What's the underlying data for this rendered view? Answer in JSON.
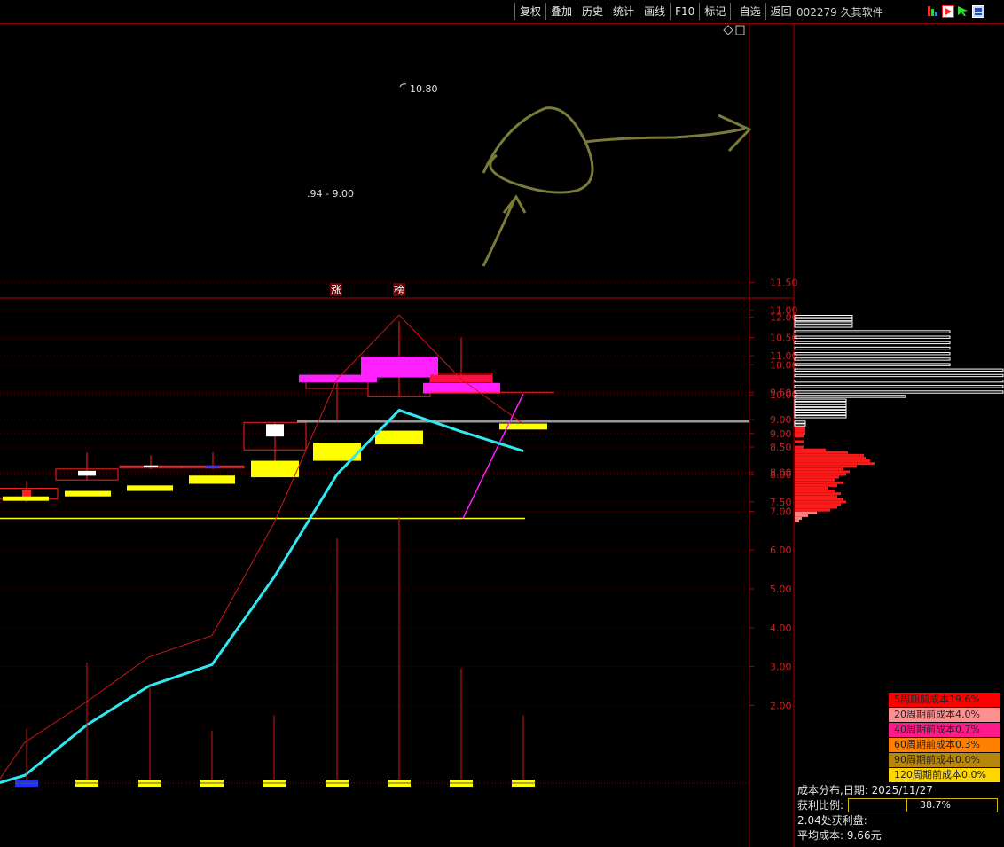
{
  "toolbar": {
    "buttons": [
      "复权",
      "叠加",
      "历史",
      "统计",
      "画线",
      "F10",
      "标记",
      "-自选",
      "返回"
    ],
    "stock_title": "002279 久其软件"
  },
  "colors": {
    "background": "#000000",
    "axis_red": "#b00000",
    "up_red": "#ff2020",
    "magenta": "#ff20ff",
    "yellow": "#ffff00",
    "cyan": "#30e8f0",
    "olive_annotation": "#7a7a3a"
  },
  "chart_data": [
    {
      "type": "candlestick",
      "panel": "price",
      "ylim": [
        7.1,
        11.85
      ],
      "yticks": [
        "11.50",
        "11.00",
        "10.50",
        "10.00",
        "9.50",
        "9.00",
        "8.50",
        "8.00",
        "7.50"
      ],
      "candles": [
        {
          "open": 7.55,
          "close": 7.75,
          "high": 7.88,
          "low": 7.5,
          "color": "red"
        },
        {
          "open": 8.1,
          "close": 7.9,
          "high": 8.4,
          "low": 7.9,
          "color": "white"
        },
        {
          "open": 8.15,
          "close": 8.15,
          "high": 8.35,
          "low": 8.1,
          "color": "doji"
        },
        {
          "open": 8.15,
          "close": 8.12,
          "high": 8.4,
          "low": 8.1,
          "color": "doji"
        },
        {
          "open": 8.95,
          "close": 8.45,
          "high": 8.95,
          "low": 7.95,
          "color": "white"
        },
        {
          "open": 9.57,
          "close": 9.8,
          "high": 9.8,
          "low": 9.0,
          "color": "red"
        },
        {
          "open": 9.42,
          "close": 9.88,
          "high": 10.8,
          "low": 9.4,
          "color": "red"
        },
        {
          "open": 9.85,
          "close": 9.55,
          "high": 10.5,
          "low": 9.5,
          "color": "red"
        }
      ],
      "yellow_boxes": [
        {
          "top": 7.6,
          "bottom": 7.52
        },
        {
          "top": 7.7,
          "bottom": 7.6
        },
        {
          "top": 7.8,
          "bottom": 7.7
        },
        {
          "top": 7.98,
          "bottom": 7.83
        },
        {
          "top": 8.25,
          "bottom": 7.95
        },
        {
          "top": 8.58,
          "bottom": 8.25
        },
        {
          "top": 8.8,
          "bottom": 8.55
        },
        {
          "top": 8.93,
          "bottom": 8.82
        }
      ],
      "magenta_boxes": [
        {
          "top": 9.82,
          "bottom": 9.68
        },
        {
          "top": 10.15,
          "bottom": 9.77
        },
        {
          "top": 9.67,
          "bottom": 9.48
        }
      ],
      "price_labels": {
        "high_label": "10.80",
        "range_label": ".94 - 9.00"
      },
      "markers": [
        "涨",
        "榜"
      ],
      "support_line": 7.2,
      "resistance_line": 8.97
    },
    {
      "type": "line",
      "panel": "indicator",
      "ylim": [
        0,
        12.3
      ],
      "yticks": [
        "12.00",
        "11.00",
        "10.00",
        "9.00",
        "8.00",
        "7.00",
        "6.00",
        "5.00",
        "4.00",
        "3.00",
        "2.00"
      ],
      "series": [
        {
          "color": "red",
          "values": [
            0.05,
            1.05,
            2.1,
            3.25,
            3.8,
            6.7,
            10.4,
            12.05,
            10.4,
            9.25
          ]
        },
        {
          "color": "cyan",
          "values": [
            0.0,
            0.2,
            1.5,
            2.5,
            3.05,
            5.3,
            7.95,
            9.6,
            9.05,
            8.55
          ]
        }
      ],
      "bars": [
        1.4,
        3.1,
        2.45,
        1.35,
        1.75,
        6.3,
        6.85,
        2.95,
        1.75
      ],
      "bar_markers": [
        "blue",
        "yellow",
        "yellow",
        "yellow",
        "yellow",
        "yellow",
        "yellow",
        "yellow",
        "yellow"
      ]
    },
    {
      "type": "bar",
      "panel": "cost_distribution",
      "ylim": [
        7.1,
        11.85
      ],
      "bins_price": [
        10.88,
        10.82,
        10.76,
        10.7,
        10.6,
        10.5,
        10.4,
        10.3,
        10.2,
        10.1,
        10.0,
        9.9,
        9.8,
        9.7,
        9.6,
        9.5,
        9.42,
        9.35,
        9.3,
        9.25,
        9.2,
        9.15,
        9.1,
        9.05,
        8.95,
        8.9,
        8.85,
        8.8,
        8.75,
        8.7,
        8.6,
        8.5,
        8.45,
        8.4,
        8.35,
        8.3,
        8.25,
        8.2,
        8.15,
        8.1,
        8.05,
        8.0,
        7.95,
        7.9,
        7.85,
        7.8,
        7.75,
        7.7,
        7.65,
        7.6,
        7.55,
        7.5,
        7.45,
        7.4,
        7.35,
        7.3,
        7.25,
        7.2,
        7.15
      ],
      "bins_value": [
        65,
        65,
        65,
        65,
        175,
        175,
        175,
        175,
        175,
        175,
        175,
        235,
        235,
        235,
        235,
        235,
        125,
        58,
        58,
        58,
        58,
        58,
        58,
        58,
        12,
        12,
        12,
        12,
        12,
        10,
        10,
        10,
        35,
        60,
        78,
        80,
        85,
        90,
        70,
        55,
        62,
        58,
        50,
        45,
        55,
        48,
        38,
        45,
        52,
        48,
        55,
        58,
        52,
        48,
        40,
        25,
        15,
        8,
        5
      ],
      "profit_colors": {
        "profit": "#ffffff",
        "loss": "#ff1a1a",
        "old": "#ff8080"
      }
    }
  ],
  "cost_legend": [
    {
      "label": "5周期前成本19.6%",
      "color": "#ff0000"
    },
    {
      "label": "20周期前成本4.0%",
      "color": "#ff9090"
    },
    {
      "label": "40周期前成本0.7%",
      "color": "#ff1a8c"
    },
    {
      "label": "60周期前成本0.3%",
      "color": "#ff7f00"
    },
    {
      "label": "90周期前成本0.0%",
      "color": "#b8860b"
    },
    {
      "label": "120周期前成本0.0%",
      "color": "#ffd700"
    }
  ],
  "cost_info": {
    "date_line": "成本分布,日期:  2025/11/27",
    "profit_label": "获利比例:",
    "profit_value": "38.7%",
    "profit_ratio": 0.387,
    "profit_chips": "2.04处获利盘:",
    "avg_cost": "平均成本:  9.66元"
  }
}
